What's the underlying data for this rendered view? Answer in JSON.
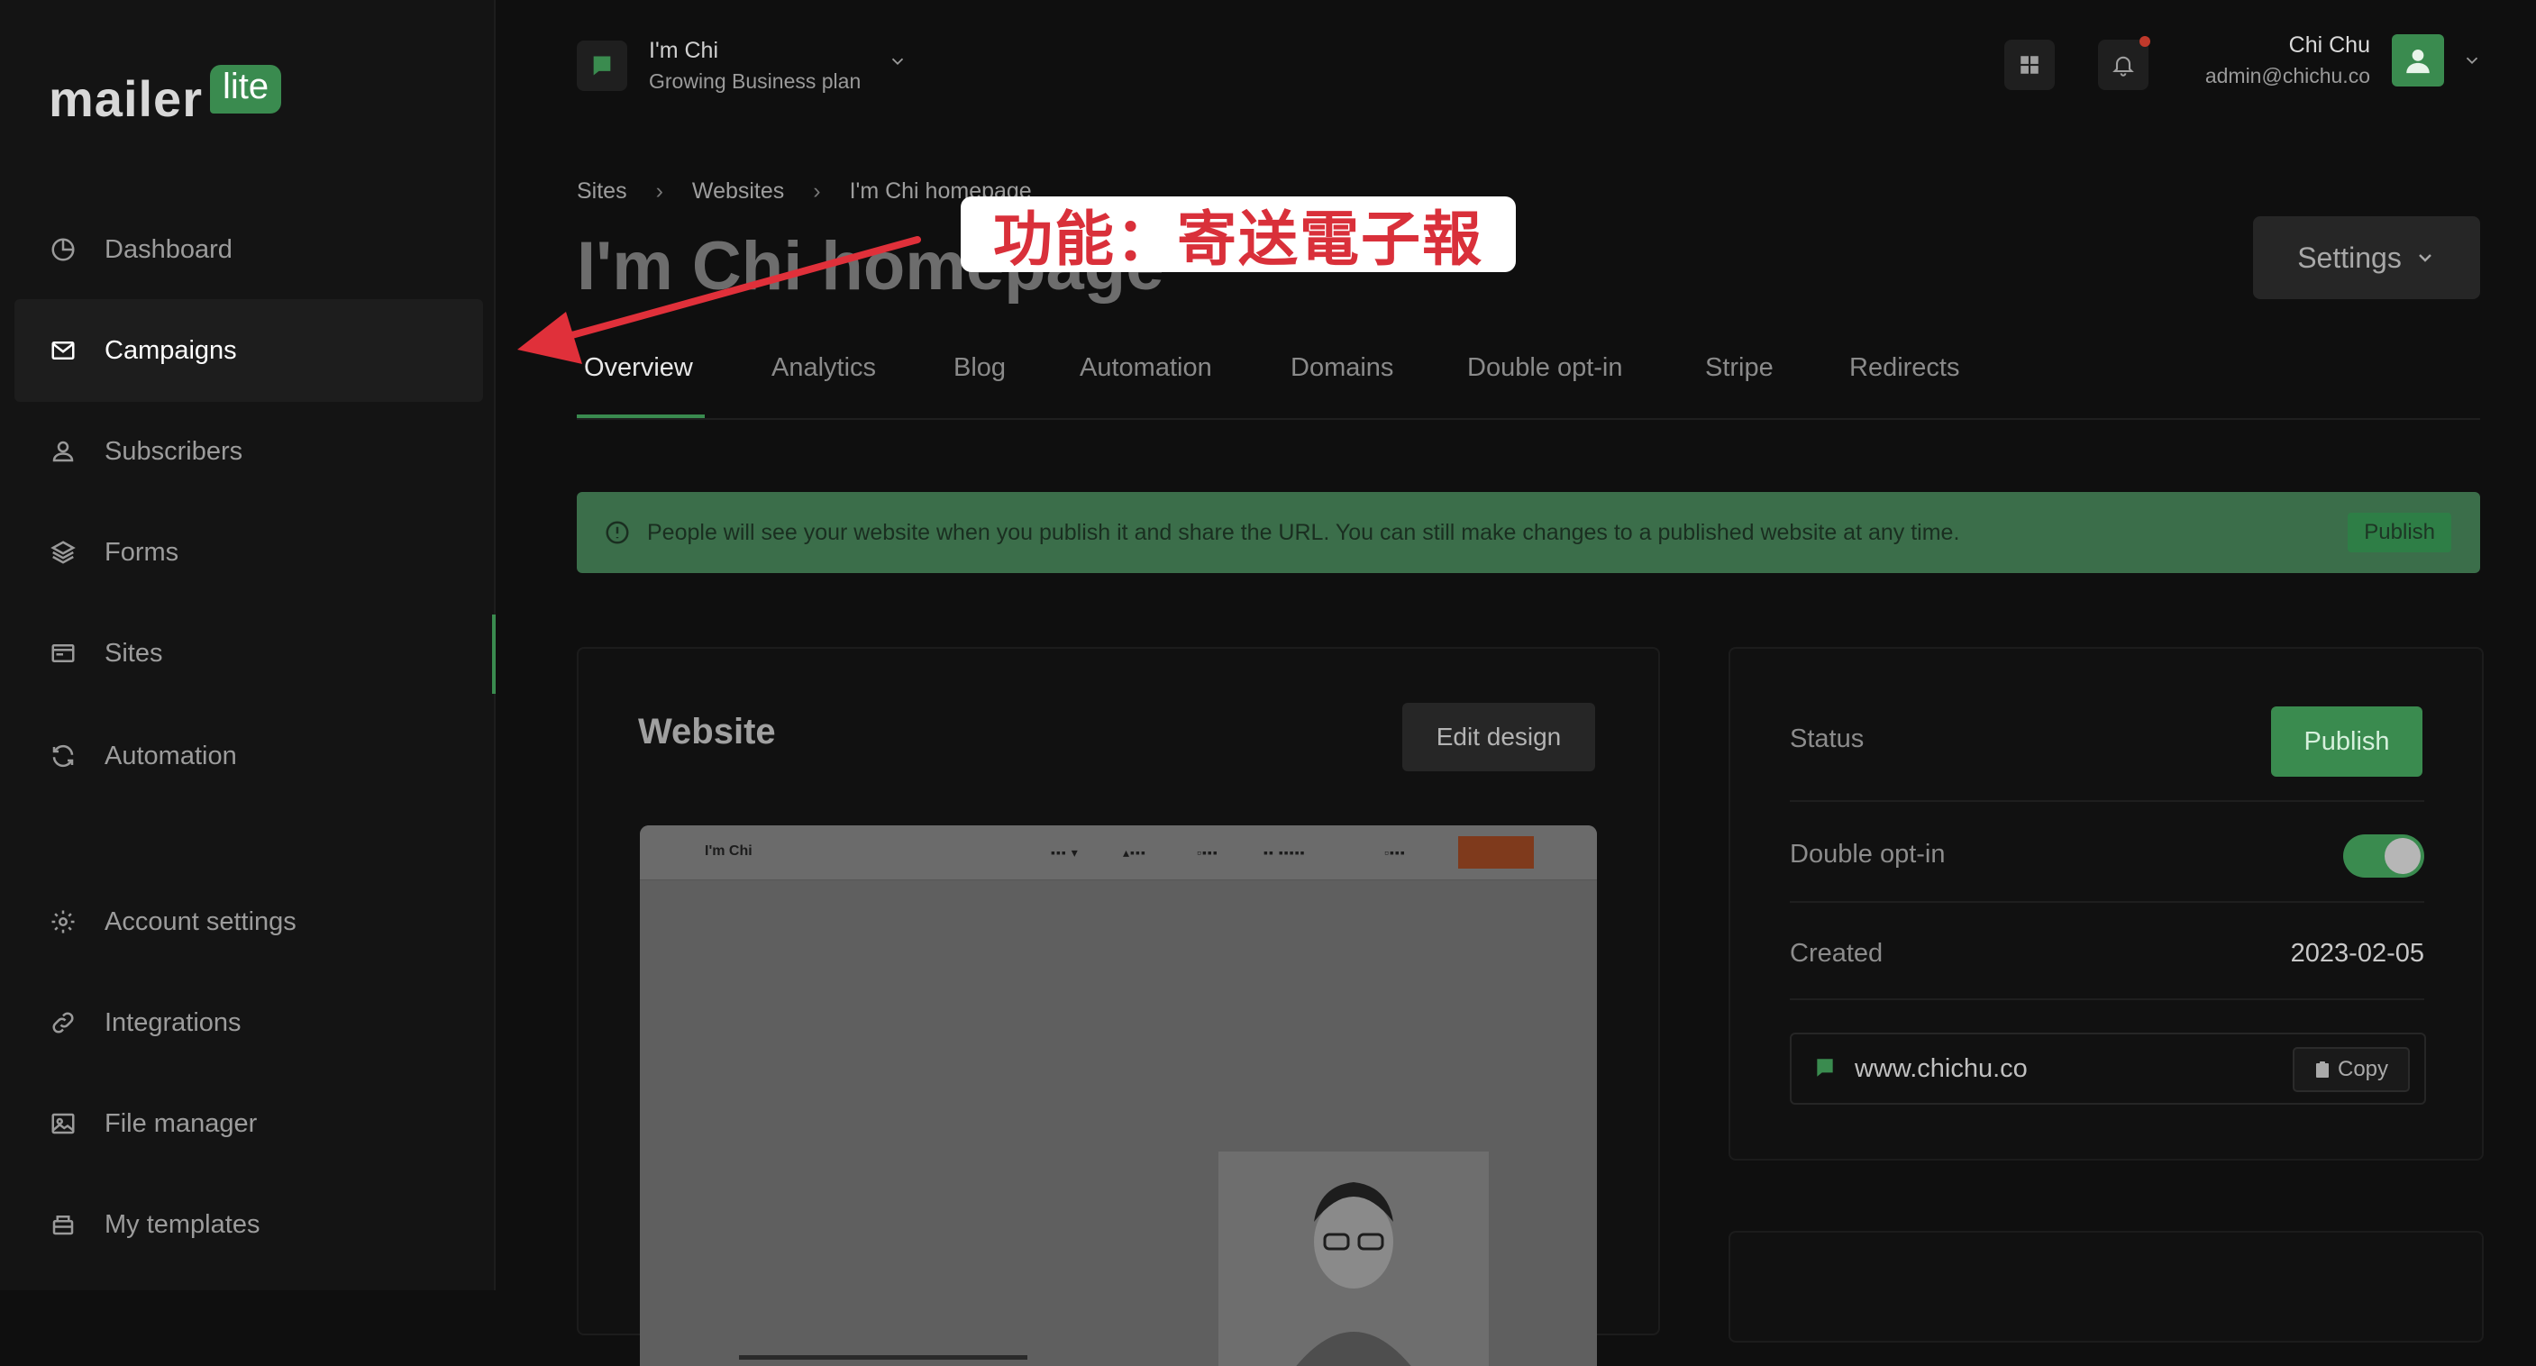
{
  "brand": {
    "logo_main": "mailer",
    "logo_badge": "lite"
  },
  "sidebar": {
    "items": [
      {
        "label": "Dashboard",
        "icon": "dashboard-icon"
      },
      {
        "label": "Campaigns",
        "icon": "mail-icon",
        "active": true
      },
      {
        "label": "Subscribers",
        "icon": "user-icon"
      },
      {
        "label": "Forms",
        "icon": "layers-icon"
      },
      {
        "label": "Sites",
        "icon": "browser-icon"
      },
      {
        "label": "Automation",
        "icon": "refresh-icon"
      },
      {
        "label": "Account settings",
        "icon": "gear-icon"
      },
      {
        "label": "Integrations",
        "icon": "link-icon"
      },
      {
        "label": "File manager",
        "icon": "image-icon"
      },
      {
        "label": "My templates",
        "icon": "template-icon"
      }
    ]
  },
  "account": {
    "name": "I'm Chi",
    "plan": "Growing Business plan"
  },
  "user": {
    "name": "Chi Chu",
    "email": "admin@chichu.co"
  },
  "breadcrumb": [
    "Sites",
    "Websites",
    "I'm Chi homepage"
  ],
  "page": {
    "title": "I'm Chi homepage",
    "settings_label": "Settings"
  },
  "tabs": [
    "Overview",
    "Analytics",
    "Blog",
    "Automation",
    "Domains",
    "Double opt-in",
    "Stripe",
    "Redirects"
  ],
  "notice": {
    "text": "People will see your website when you publish it and share the URL. You can still make changes to a published website at any time.",
    "button": "Publish"
  },
  "website_card": {
    "title": "Website",
    "edit_button": "Edit design",
    "preview": {
      "brand": "I'm Chi"
    }
  },
  "status_card": {
    "status_label": "Status",
    "publish_button": "Publish",
    "double_optin_label": "Double opt-in",
    "double_optin_enabled": true,
    "created_label": "Created",
    "created_value": "2023-02-05",
    "url": "www.chichu.co",
    "copy_button": "Copy"
  },
  "annotation": {
    "text": "功能：寄送電子報",
    "color": "#d9303a"
  },
  "colors": {
    "accent": "#3a8b4f",
    "background": "#0f0f0f",
    "sidebar": "#141414"
  }
}
